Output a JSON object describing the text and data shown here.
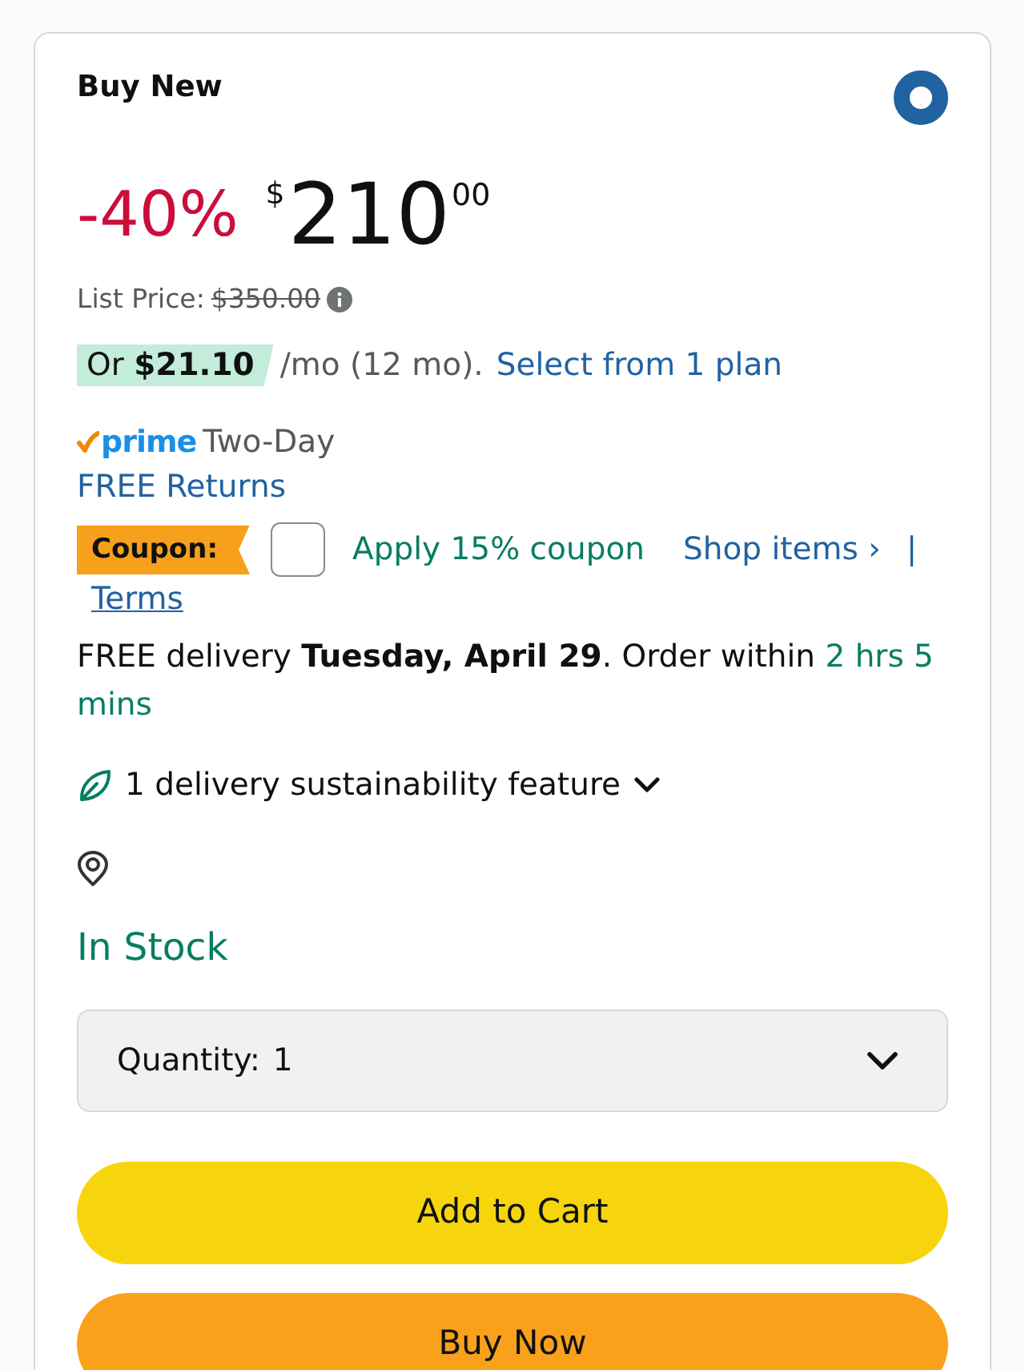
{
  "offer": {
    "title": "Buy New",
    "selected": true
  },
  "price": {
    "discount": "-40%",
    "currency": "$",
    "whole": "210",
    "fraction": "00"
  },
  "list_price": {
    "label": "List Price:",
    "value": "$350.00"
  },
  "installment": {
    "highlight": "Or **$21.10**",
    "text": "/mo (12 mo).",
    "link": "Select from 1 plan"
  },
  "shipping": {
    "badge": "prime",
    "speed": "Two-Day"
  },
  "returns_link": "FREE Returns",
  "coupon": {
    "badge": "Coupon:",
    "checked": false,
    "label": "Apply 15% coupon",
    "shop_link": "Shop items ›",
    "separator": "|",
    "terms_link": "Terms"
  },
  "delivery": {
    "text": "FREE delivery **Tuesday, April 29**. Order within",
    "countdown": "2 hrs 5 mins"
  },
  "sustainability": {
    "label": "1 delivery sustainability feature",
    "expanded": false
  },
  "availability": "In Stock",
  "quantity": {
    "label": "Quantity:",
    "value": "1"
  },
  "buttons": [
    {
      "label": "Add to Cart",
      "kind": "cart"
    },
    {
      "label": "Buy Now",
      "kind": "buy"
    }
  ]
}
